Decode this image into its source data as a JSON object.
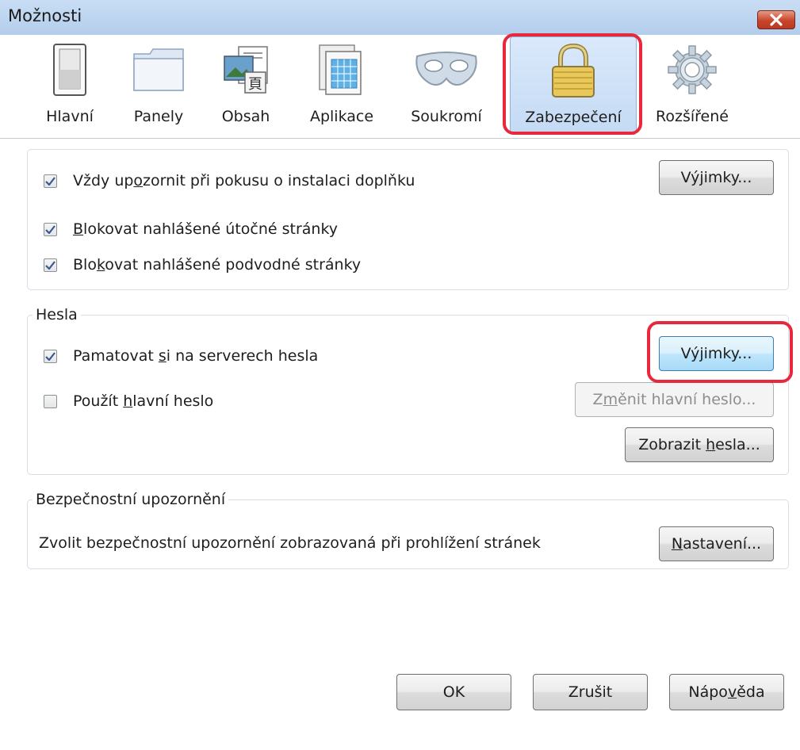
{
  "window": {
    "title": "Možnosti",
    "close_icon": "close-icon"
  },
  "toolbar": {
    "tabs": [
      {
        "label": "Hlavní",
        "icon": "switch-icon",
        "selected": false
      },
      {
        "label": "Panely",
        "icon": "folder-tab-icon",
        "selected": false
      },
      {
        "label": "Obsah",
        "icon": "content-icon",
        "selected": false
      },
      {
        "label": "Aplikace",
        "icon": "applications-icon",
        "selected": false
      },
      {
        "label": "Soukromí",
        "icon": "mask-icon",
        "selected": false
      },
      {
        "label": "Zabezpečení",
        "icon": "lock-icon",
        "selected": true
      },
      {
        "label": "Rozšířené",
        "icon": "gear-icon",
        "selected": false
      }
    ]
  },
  "addons_group": {
    "warn_install": {
      "pre": "Vždy up",
      "key": "o",
      "post": "zornit při pokusu o instalaci doplňku",
      "checked": true
    },
    "exceptions_button": {
      "pre": "Vý",
      "key": "j",
      "post": "imky..."
    },
    "block_attack": {
      "pre": "",
      "key": "B",
      "post": "lokovat nahlášené útočné stránky",
      "checked": true
    },
    "block_forgery": {
      "pre": "Blo",
      "key": "k",
      "post": "ovat nahlášené podvodné stránky",
      "checked": true
    }
  },
  "passwords_group": {
    "caption": "Hesla",
    "remember": {
      "pre": "Pamatovat ",
      "key": "s",
      "post": "i na serverech hesla",
      "checked": true
    },
    "exceptions_button": {
      "pre": "Vý",
      "key": "j",
      "post": "imky..."
    },
    "master": {
      "pre": "Použít ",
      "key": "h",
      "post": "lavní heslo",
      "checked": false
    },
    "change_master_button": {
      "pre": "Z",
      "key": "m",
      "post": "ěnit hlavní heslo..."
    },
    "show_passwords_button": {
      "pre": "Zobrazit ",
      "key": "h",
      "post": "esla..."
    }
  },
  "warnings_group": {
    "caption": "Bezpečnostní upozornění",
    "description": "Zvolit bezpečnostní upozornění zobrazovaná při prohlížení stránek",
    "settings_button": {
      "pre": "",
      "key": "N",
      "post": "astavení..."
    }
  },
  "footer": {
    "ok_label": "OK",
    "cancel_label": "Zrušit",
    "help_button": {
      "pre": "Nápo",
      "key": "v",
      "post": "ěda"
    }
  },
  "colors": {
    "highlight": "#e8293d",
    "titlebar": "#b3cdec",
    "selected_tab": "#c4daf4"
  }
}
